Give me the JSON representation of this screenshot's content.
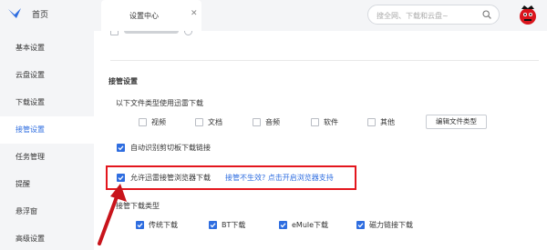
{
  "sidebar": {
    "home_label": "首页",
    "items": [
      {
        "label": "基本设置",
        "active": false
      },
      {
        "label": "云盘设置",
        "active": false
      },
      {
        "label": "下载设置",
        "active": false
      },
      {
        "label": "接管设置",
        "active": true
      },
      {
        "label": "任务管理",
        "active": false
      },
      {
        "label": "提醒",
        "active": false
      },
      {
        "label": "悬浮窗",
        "active": false
      },
      {
        "label": "高级设置",
        "active": false
      }
    ]
  },
  "topbar": {
    "tab_label": "设置中心",
    "close_glyph": "✕",
    "search_placeholder": "搜全网、下载和云盘~"
  },
  "content": {
    "section_title": "接管设置",
    "filetypes_label": "以下文件类型使用迅雷下载",
    "filetypes": [
      {
        "label": "视频",
        "checked": false
      },
      {
        "label": "文档",
        "checked": false
      },
      {
        "label": "音频",
        "checked": false
      },
      {
        "label": "软件",
        "checked": false
      },
      {
        "label": "其他",
        "checked": false
      }
    ],
    "edit_button_label": "编辑文件类型",
    "clipboard_label": "自动识别剪切板下载链接",
    "clipboard_checked": true,
    "browser_label": "允许迅雷接管浏览器下载",
    "browser_checked": true,
    "browser_link": "接管不生效? 点击开启浏览器支持",
    "download_types_label": "接管下载类型",
    "download_types": [
      {
        "label": "传统下载",
        "checked": true
      },
      {
        "label": "BT下载",
        "checked": true
      },
      {
        "label": "eMule下载",
        "checked": true
      },
      {
        "label": "磁力链接下载",
        "checked": true
      }
    ]
  },
  "colors": {
    "accent": "#2e6de0",
    "highlight_box": "#e3161d",
    "checkbox_checked": "#2e6de0"
  },
  "icons": {
    "logo": "xunlei-bird-icon",
    "search": "search-icon",
    "close": "close-icon",
    "avatar": "avatar-icon",
    "checkmark": "checkmark-icon",
    "arrow": "red-arrow-annotation"
  }
}
